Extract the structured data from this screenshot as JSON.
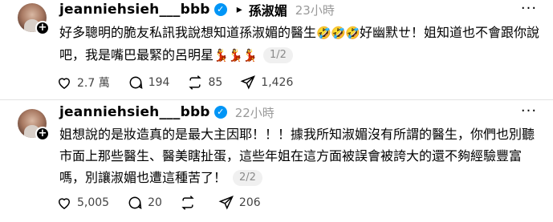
{
  "posts": [
    {
      "username": "jeanniehsieh___bbb",
      "reply_arrow": "▸",
      "mention": "孫淑媚",
      "time": "23小時",
      "text_a": "好多聰明的脆友私訊我說想知道孫淑媚的醫生",
      "text_b": "好幽默ㄝ！姐知道也不會跟你說吧，我是嘴巴最緊的呂明星",
      "emoji_laugh": "🤣",
      "emoji_dance": "💃",
      "page": "1/2",
      "likes": "2.7 萬",
      "comments": "194",
      "reposts": "85",
      "shares": "1,426"
    },
    {
      "username": "jeanniehsieh___bbb",
      "time": "22小時",
      "text": "姐想說的是妝造真的是最大主因耶！！！據我所知淑媚沒有所謂的醫生，你們也別聽市面上那些醫生、醫美瞎扯蛋，這些年姐在這方面被誤會被誇大的還不夠經驗豐富嗎，別讓淑媚也遭這種苦了！",
      "page": "2/2",
      "likes": "5,005",
      "comments": "20",
      "reposts": "",
      "shares": "206"
    }
  ],
  "icons": {
    "heart": "heart-icon",
    "comment": "comment-icon",
    "repost": "repost-icon",
    "share": "share-icon",
    "more": "more-icon",
    "verified": "verified-badge-icon",
    "follow": "follow-plus-icon"
  },
  "colors": {
    "verified": "#0095f6",
    "muted": "#999999",
    "pill_bg": "#f0f0f0"
  }
}
